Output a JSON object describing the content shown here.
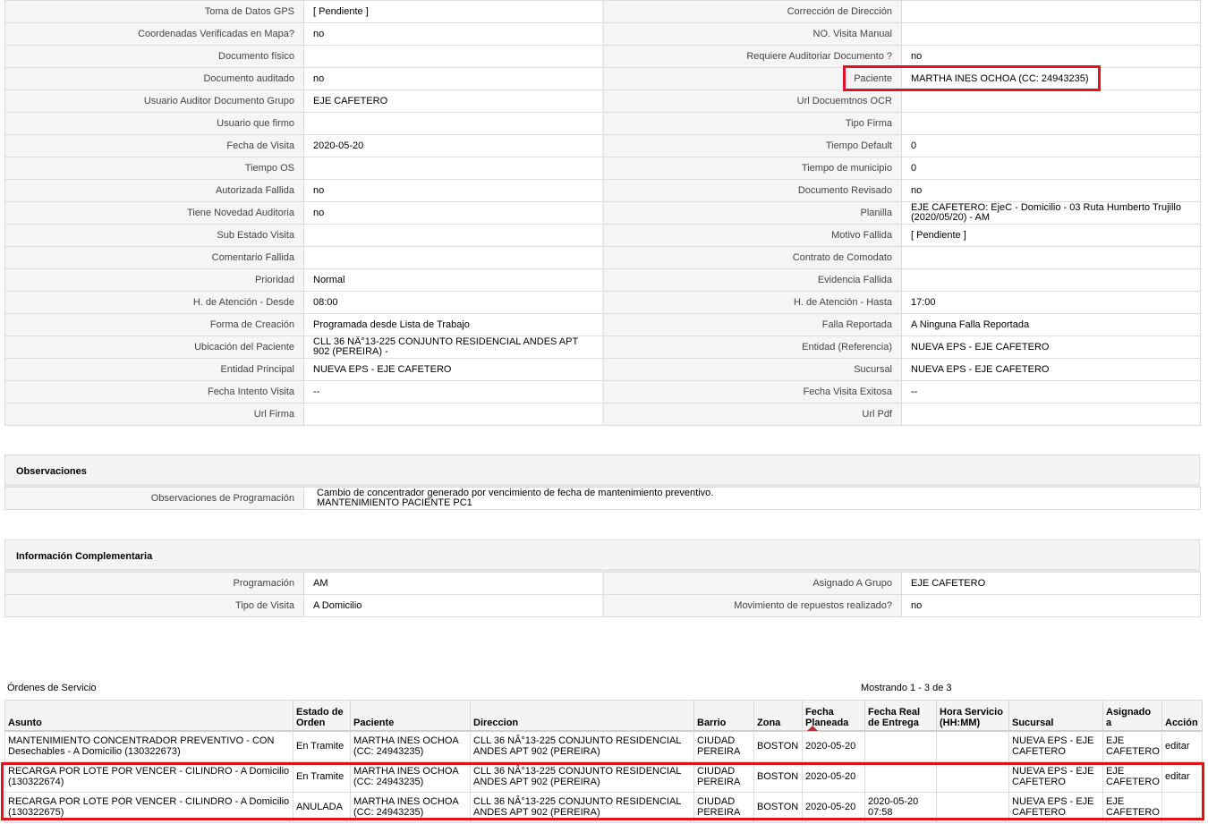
{
  "details": {
    "rows": [
      {
        "l1": "Toma de Datos GPS",
        "v1": "[ Pendiente ]",
        "l2": "Corrección de Dirección",
        "v2": ""
      },
      {
        "l1": "Coordenadas Verificadas en Mapa?",
        "v1": "no",
        "l2": "NO. Visita Manual",
        "v2": ""
      },
      {
        "l1": "Documento físico",
        "v1": "",
        "l2": "Requiere Auditoriar Documento ?",
        "v2": "no"
      },
      {
        "l1": "Documento auditado",
        "v1": "no",
        "l2": "Paciente",
        "v2": "MARTHA INES OCHOA (CC: 24943235)"
      },
      {
        "l1": "Usuario Auditor Documento Grupo",
        "v1": "EJE CAFETERO",
        "l2": "Url Docuemtnos OCR",
        "v2": ""
      },
      {
        "l1": "Usuario que firmo",
        "v1": "",
        "l2": "Tipo Firma",
        "v2": ""
      },
      {
        "l1": "Fecha de Visita",
        "v1": "2020-05-20",
        "l2": "Tiempo Default",
        "v2": "0"
      },
      {
        "l1": "Tiempo OS",
        "v1": "",
        "l2": "Tiempo de municipio",
        "v2": "0"
      },
      {
        "l1": "Autorizada Fallida",
        "v1": "no",
        "l2": "Documento Revisado",
        "v2": "no"
      },
      {
        "l1": "Tiene Novedad Auditoria",
        "v1": "no",
        "l2": "Planilla",
        "v2": "EJE CAFETERO: EjeC - Domicilio - 03 Ruta Humberto Trujillo (2020/05/20) - AM"
      },
      {
        "l1": "Sub Estado Visita",
        "v1": "",
        "l2": "Motivo Fallida",
        "v2": "[ Pendiente ]"
      },
      {
        "l1": "Comentario Fallida",
        "v1": "",
        "l2": "Contrato de Comodato",
        "v2": ""
      },
      {
        "l1": "Prioridad",
        "v1": "Normal",
        "l2": "Evidencia Fallida",
        "v2": ""
      },
      {
        "l1": "H. de Atención - Desde",
        "v1": "08:00",
        "l2": "H. de Atención - Hasta",
        "v2": "17:00"
      },
      {
        "l1": "Forma de Creación",
        "v1": "Programada desde Lista de Trabajo",
        "l2": "Falla Reportada",
        "v2": "A Ninguna Falla Reportada"
      },
      {
        "l1": "Ubicación del Paciente",
        "v1": "CLL 36 NÂ°13-225 CONJUNTO RESIDENCIAL ANDES APT 902 (PEREIRA) -",
        "l2": "Entidad (Referencia)",
        "v2": "NUEVA EPS - EJE CAFETERO"
      },
      {
        "l1": "Entidad Principal",
        "v1": "NUEVA EPS - EJE CAFETERO",
        "l2": "Sucursal",
        "v2": "NUEVA EPS - EJE CAFETERO"
      },
      {
        "l1": "Fecha Intento Visita",
        "v1": "--",
        "l2": "Fecha Visita Exitosa",
        "v2": "--"
      },
      {
        "l1": "Url Firma",
        "v1": "",
        "l2": "Url Pdf",
        "v2": ""
      }
    ]
  },
  "observaciones": {
    "title": "Observaciones",
    "label": "Observaciones de Programación",
    "line1": "Cambio de concentrador generado por vencimiento de fecha de mantenimiento preventivo.",
    "line2": "MANTENIMIENTO PACIENTE PC1"
  },
  "complementaria": {
    "title": "Información Complementaria",
    "rows": [
      {
        "l1": "Programación",
        "v1": "AM",
        "l2": "Asignado A Grupo",
        "v2": "EJE CAFETERO"
      },
      {
        "l1": "Tipo de Visita",
        "v1": "A Domicilio",
        "l2": "Movimiento de repuestos realizado?",
        "v2": "no"
      }
    ]
  },
  "orders": {
    "title": "Órdenes de Servicio",
    "count": "Mostrando 1 - 3 de 3",
    "headers": {
      "asunto": "Asunto",
      "estado": "Estado de Orden",
      "paciente": "Paciente",
      "direccion": "Direccion",
      "barrio": "Barrio",
      "zona": "Zona",
      "fecha_planeada": "Fecha Planeada",
      "fecha_real": "Fecha Real de Entrega",
      "hora": "Hora Servicio (HH:MM)",
      "sucursal": "Sucursal",
      "asignado": "Asignado a",
      "accion": "Acción"
    },
    "rows": [
      {
        "asunto": "MANTENIMIENTO CONCENTRADOR PREVENTIVO - CON Desechables - A Domicilio (130322673)",
        "estado": "En Tramite",
        "paciente": "MARTHA INES OCHOA (CC: 24943235)",
        "direccion": "CLL 36 NÂ°13-225 CONJUNTO RESIDENCIAL ANDES APT 902 (PEREIRA)",
        "barrio": "CIUDAD PEREIRA",
        "zona": "BOSTON",
        "fecha_planeada": "2020-05-20",
        "fecha_real": "",
        "hora": "",
        "sucursal": "NUEVA EPS - EJE CAFETERO",
        "asignado": "EJE CAFETERO",
        "accion": "editar"
      },
      {
        "asunto": "RECARGA POR LOTE POR VENCER - CILINDRO - A Domicilio (130322674)",
        "estado": "En Tramite",
        "paciente": "MARTHA INES OCHOA (CC: 24943235)",
        "direccion": "CLL 36 NÂ°13-225 CONJUNTO RESIDENCIAL ANDES APT 902 (PEREIRA)",
        "barrio": "CIUDAD PEREIRA",
        "zona": "BOSTON",
        "fecha_planeada": "2020-05-20",
        "fecha_real": "",
        "hora": "",
        "sucursal": "NUEVA EPS - EJE CAFETERO",
        "asignado": "EJE CAFETERO",
        "accion": "editar"
      },
      {
        "asunto": "RECARGA POR LOTE POR VENCER - CILINDRO - A Domicilio (130322675)",
        "estado": "ANULADA",
        "paciente": "MARTHA INES OCHOA (CC: 24943235)",
        "direccion": "CLL 36 NÂ°13-225 CONJUNTO RESIDENCIAL ANDES APT 902 (PEREIRA)",
        "barrio": "CIUDAD PEREIRA",
        "zona": "BOSTON",
        "fecha_planeada": "2020-05-20",
        "fecha_real": "2020-05-20 07:58",
        "hora": "",
        "sucursal": "NUEVA EPS - EJE CAFETERO",
        "asignado": "EJE CAFETERO",
        "accion": ""
      }
    ]
  },
  "highlight_color": "#e0141e"
}
